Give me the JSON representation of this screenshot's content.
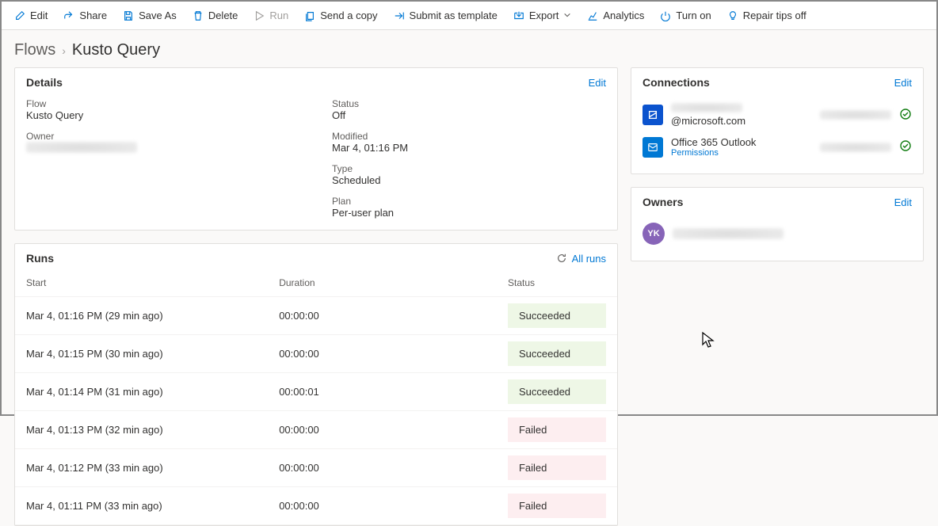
{
  "toolbar": [
    {
      "icon": "edit",
      "label": "Edit",
      "disabled": false
    },
    {
      "icon": "share",
      "label": "Share",
      "disabled": false
    },
    {
      "icon": "saveas",
      "label": "Save As",
      "disabled": false
    },
    {
      "icon": "delete",
      "label": "Delete",
      "disabled": false
    },
    {
      "icon": "run",
      "label": "Run",
      "disabled": true
    },
    {
      "icon": "copy",
      "label": "Send a copy",
      "disabled": false
    },
    {
      "icon": "submit",
      "label": "Submit as template",
      "disabled": false
    },
    {
      "icon": "export",
      "label": "Export",
      "chevron": true,
      "disabled": false
    },
    {
      "icon": "analytics",
      "label": "Analytics",
      "disabled": false
    },
    {
      "icon": "turnon",
      "label": "Turn on",
      "disabled": false
    },
    {
      "icon": "repair",
      "label": "Repair tips off",
      "disabled": false
    }
  ],
  "breadcrumb": {
    "root": "Flows",
    "current": "Kusto Query"
  },
  "details": {
    "title": "Details",
    "edit": "Edit",
    "flow_label": "Flow",
    "flow_value": "Kusto Query",
    "owner_label": "Owner",
    "status_label": "Status",
    "status_value": "Off",
    "modified_label": "Modified",
    "modified_value": "Mar 4, 01:16 PM",
    "type_label": "Type",
    "type_value": "Scheduled",
    "plan_label": "Plan",
    "plan_value": "Per-user plan"
  },
  "connections": {
    "title": "Connections",
    "edit": "Edit",
    "items": [
      {
        "icon": "blue",
        "name_suffix": "@microsoft.com",
        "sub": "",
        "ok": true
      },
      {
        "icon": "lightblue",
        "name": "Office 365 Outlook",
        "sub": "Permissions",
        "ok": true
      }
    ]
  },
  "owners": {
    "title": "Owners",
    "edit": "Edit",
    "avatar_initials": "YK"
  },
  "runs": {
    "title": "Runs",
    "allruns": "All runs",
    "columns": [
      "Start",
      "Duration",
      "Status"
    ],
    "rows": [
      {
        "start": "Mar 4, 01:16 PM (29 min ago)",
        "duration": "00:00:00",
        "status": "Succeeded"
      },
      {
        "start": "Mar 4, 01:15 PM (30 min ago)",
        "duration": "00:00:00",
        "status": "Succeeded"
      },
      {
        "start": "Mar 4, 01:14 PM (31 min ago)",
        "duration": "00:00:01",
        "status": "Succeeded"
      },
      {
        "start": "Mar 4, 01:13 PM (32 min ago)",
        "duration": "00:00:00",
        "status": "Failed"
      },
      {
        "start": "Mar 4, 01:12 PM (33 min ago)",
        "duration": "00:00:00",
        "status": "Failed"
      },
      {
        "start": "Mar 4, 01:11 PM (33 min ago)",
        "duration": "00:00:00",
        "status": "Failed"
      }
    ]
  }
}
